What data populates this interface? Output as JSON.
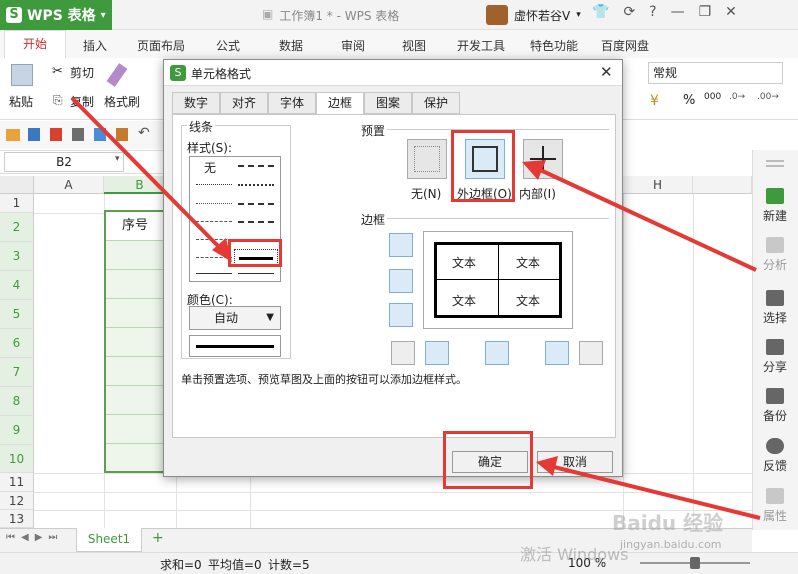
{
  "titlebar": {
    "app_name": "WPS 表格",
    "window_title": "工作簿1 * - WPS 表格",
    "user_name": "虚怀若谷V",
    "help": "?",
    "minimize": "—",
    "restore": "❐",
    "close": "✕"
  },
  "menu": {
    "tabs": [
      "开始",
      "插入",
      "页面布局",
      "公式",
      "数据",
      "审阅",
      "视图",
      "开发工具",
      "特色功能",
      "百度网盘"
    ]
  },
  "ribbon": {
    "cut": "剪切",
    "paste": "粘贴",
    "copy": "复制",
    "format_painter": "格式刷",
    "number_format": "常规",
    "percent": "%",
    "comma": "000"
  },
  "formula": {
    "cell_ref": "B2"
  },
  "grid": {
    "columns": [
      "A",
      "B",
      "C",
      "D",
      "E",
      "F",
      "G",
      "H"
    ],
    "rows": [
      "1",
      "2",
      "3",
      "4",
      "5",
      "6",
      "7",
      "8",
      "9",
      "10",
      "11",
      "12",
      "13"
    ],
    "b2_text": "序号"
  },
  "right_panel": {
    "items": [
      "新建",
      "分析",
      "选择",
      "分享",
      "备份",
      "反馈",
      "属性"
    ]
  },
  "sheet": {
    "tab": "Sheet1"
  },
  "status": {
    "sum": "求和=0",
    "avg": "平均值=0",
    "count": "计数=5",
    "zoom": "100 %",
    "watermark": "激活 Windows",
    "baidu": "Baidu 经验",
    "baidu_url": "jingyan.baidu.com"
  },
  "dialog": {
    "title": "单元格格式",
    "tabs": [
      "数字",
      "对齐",
      "字体",
      "边框",
      "图案",
      "保护"
    ],
    "active_tab_index": 3,
    "line_group": "线条",
    "style_label": "样式(S):",
    "none_style": "无",
    "color_label": "颜色(C):",
    "color_value": "自动",
    "preset_group": "预置",
    "preset_none": "无(N)",
    "preset_outline": "外边框(O)",
    "preset_inside": "内部(I)",
    "border_group": "边框",
    "preview_text": "文本",
    "hint": "单击预置选项、预览草图及上面的按钮可以添加边框样式。",
    "ok": "确定",
    "cancel": "取消"
  },
  "colors": {
    "accent_green": "#3f9a3d",
    "highlight_red": "#e53935",
    "menu_active": "#d02c2c"
  }
}
